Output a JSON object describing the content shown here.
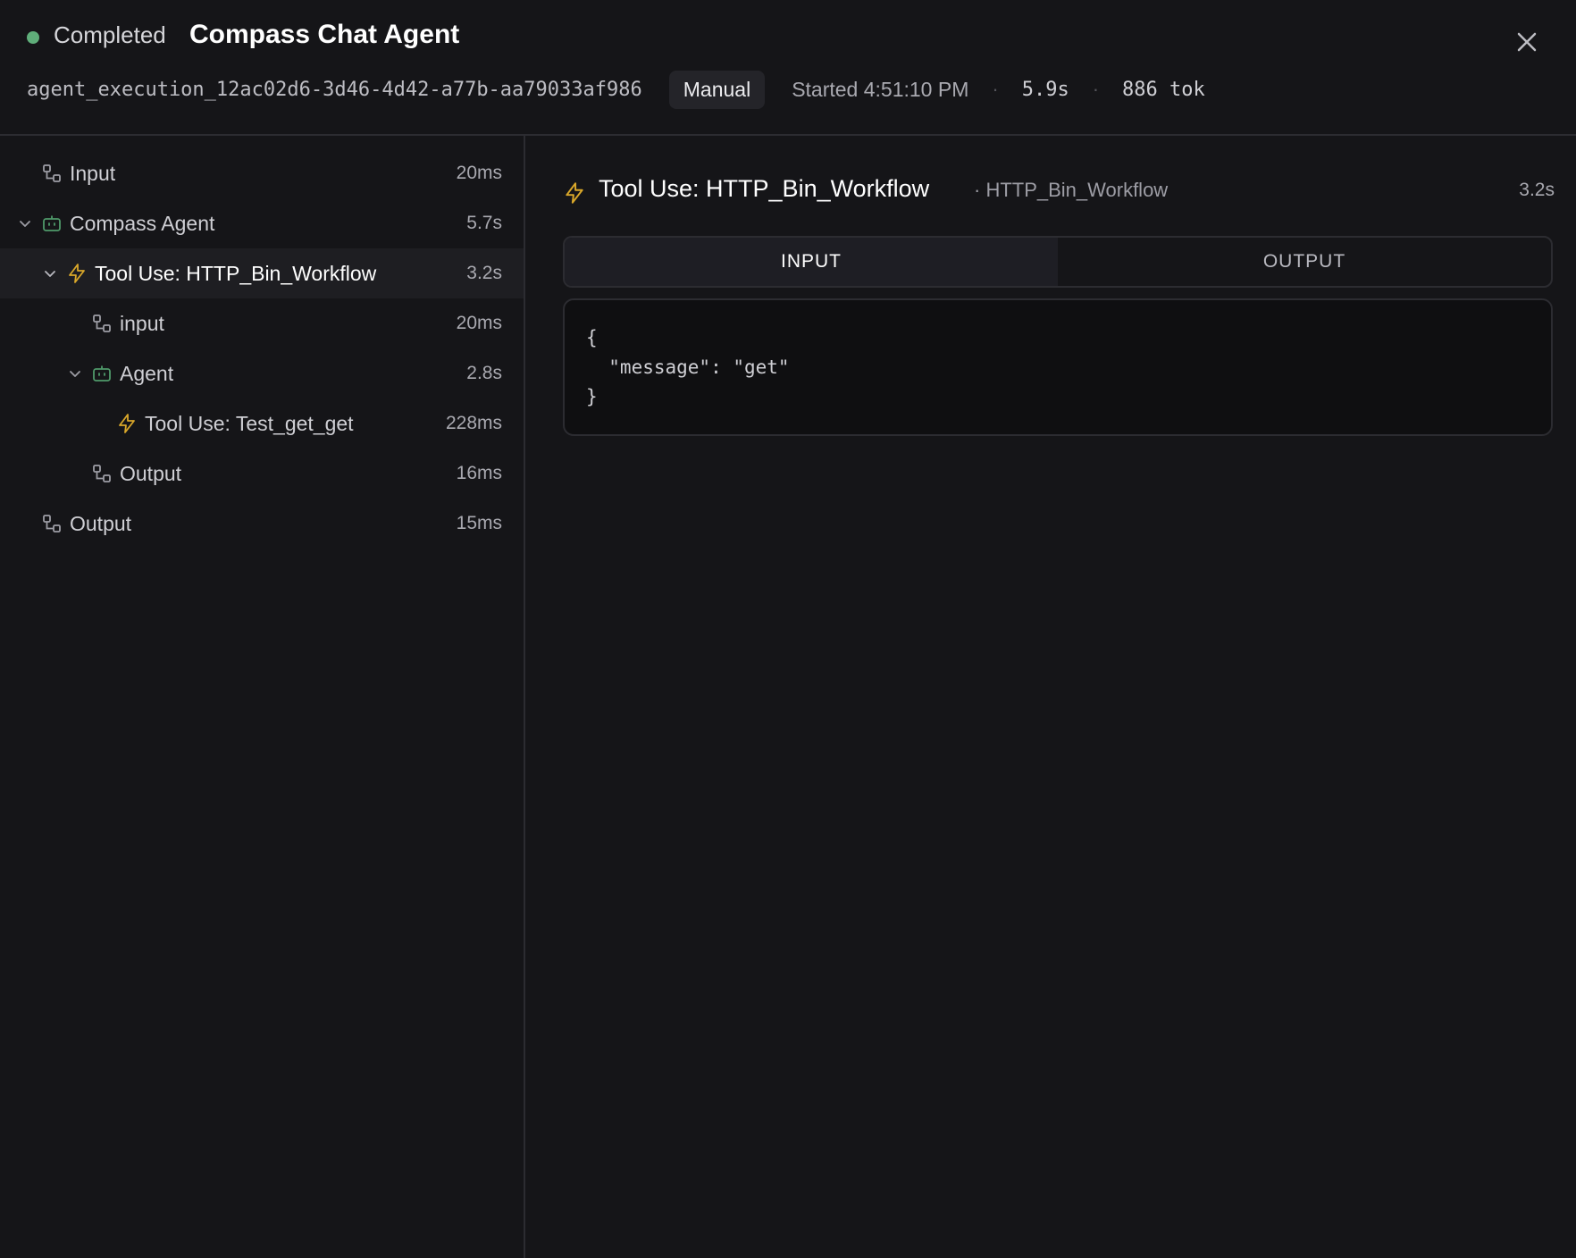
{
  "header": {
    "status": "Completed",
    "title": "Compass Chat Agent",
    "execution_id": "agent_execution_12ac02d6-3d46-4d42-a77b-aa79033af986",
    "trigger_badge": "Manual",
    "started": "Started 4:51:10 PM",
    "separator": "·",
    "duration": "5.9s",
    "tokens": "886 tok",
    "status_color": "#5fae7a"
  },
  "tree": [
    {
      "label": "Input",
      "duration": "20ms",
      "icon": "flow-node-icon"
    },
    {
      "label": "Compass Agent",
      "duration": "5.7s",
      "icon": "robot-icon"
    },
    {
      "label": "Tool Use: HTTP_Bin_Workflow",
      "duration": "3.2s",
      "icon": "lightning-icon"
    },
    {
      "label": "input",
      "duration": "20ms",
      "icon": "flow-node-icon"
    },
    {
      "label": "Agent",
      "duration": "2.8s",
      "icon": "robot-icon"
    },
    {
      "label": "Tool Use: Test_get_get",
      "duration": "228ms",
      "icon": "lightning-icon"
    },
    {
      "label": "Output",
      "duration": "16ms",
      "icon": "flow-node-icon"
    },
    {
      "label": "Output",
      "duration": "15ms",
      "icon": "flow-node-icon"
    }
  ],
  "detail": {
    "title": "Tool Use: HTTP_Bin_Workflow",
    "subtitle": "· HTTP_Bin_Workflow",
    "duration": "3.2s",
    "tabs": [
      "INPUT",
      "OUTPUT"
    ],
    "active_tab": "INPUT",
    "code": "{\n  \"message\": \"get\"\n}"
  }
}
